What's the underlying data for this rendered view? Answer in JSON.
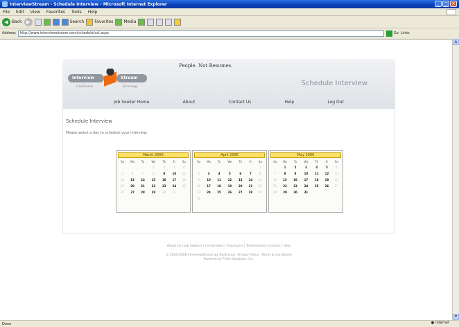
{
  "window": {
    "title": "InterviewStream - Schedule Interview - Microsoft Internet Explorer"
  },
  "menu": [
    "File",
    "Edit",
    "View",
    "Favorites",
    "Tools",
    "Help"
  ],
  "toolbar": {
    "back": "Back",
    "search": "Search",
    "favorites": "Favorites",
    "media": "Media"
  },
  "address": {
    "label": "Address",
    "url": "http://www.interviewstream.com/schedule/cal.aspx",
    "go": "Go",
    "links": "Links"
  },
  "status": {
    "left": "Done",
    "zone": "Internet"
  },
  "site": {
    "logo_left": "Interview",
    "logo_right": "Stream",
    "logo_left_sub": "A RedFusion",
    "logo_right_sub": "Technology",
    "tagline": "People. Not Resumes.",
    "section_title": "Schedule Interview",
    "nav": [
      "Job Seeker Home",
      "About",
      "Contact Us",
      "Help",
      "Log Out"
    ]
  },
  "main": {
    "title": "Schedule Interview",
    "hint": "Please select a day to schedule your interview:"
  },
  "calendars": [
    {
      "month": "March 2006",
      "weekdays": [
        "Su",
        "Mo",
        "Tu",
        "We",
        "Th",
        "Fr",
        "Sa"
      ],
      "rows": [
        [
          "",
          "",
          "",
          "1",
          "2",
          "3",
          "4"
        ],
        [
          "5",
          "6",
          "7",
          "8",
          "9",
          "10",
          "11"
        ],
        [
          "12",
          "13",
          "14",
          "15",
          "16",
          "17",
          "18"
        ],
        [
          "19",
          "20",
          "21",
          "22",
          "23",
          "24",
          "25"
        ],
        [
          "26",
          "27",
          "28",
          "29",
          "30",
          "31",
          ""
        ]
      ],
      "bold": [
        "9",
        "10",
        "13",
        "14",
        "15",
        "16",
        "17",
        "20",
        "21",
        "22",
        "23",
        "24",
        "27",
        "28",
        "29"
      ]
    },
    {
      "month": "April 2006",
      "weekdays": [
        "Su",
        "Mo",
        "Tu",
        "We",
        "Th",
        "Fr",
        "Sa"
      ],
      "rows": [
        [
          "",
          "",
          "",
          "",
          "",
          "",
          "1"
        ],
        [
          "2",
          "3",
          "4",
          "5",
          "6",
          "7",
          "8"
        ],
        [
          "9",
          "10",
          "11",
          "12",
          "13",
          "14",
          "15"
        ],
        [
          "16",
          "17",
          "18",
          "19",
          "20",
          "21",
          "22"
        ],
        [
          "23",
          "24",
          "25",
          "26",
          "27",
          "28",
          "29"
        ],
        [
          "30",
          "",
          "",
          "",
          "",
          "",
          ""
        ]
      ],
      "bold": [
        "3",
        "4",
        "5",
        "6",
        "7",
        "10",
        "11",
        "12",
        "13",
        "14",
        "17",
        "18",
        "19",
        "20",
        "21",
        "24",
        "25",
        "26",
        "27",
        "28"
      ]
    },
    {
      "month": "May 2006",
      "weekdays": [
        "Su",
        "Mo",
        "Tu",
        "We",
        "Th",
        "Fr",
        "Sa"
      ],
      "rows": [
        [
          "",
          "1",
          "2",
          "3",
          "4",
          "5",
          "6"
        ],
        [
          "7",
          "8",
          "9",
          "10",
          "11",
          "12",
          "13"
        ],
        [
          "14",
          "15",
          "16",
          "17",
          "18",
          "19",
          "20"
        ],
        [
          "21",
          "22",
          "23",
          "24",
          "25",
          "26",
          "27"
        ],
        [
          "28",
          "29",
          "30",
          "31",
          "",
          "",
          ""
        ]
      ],
      "bold": [
        "1",
        "2",
        "3",
        "4",
        "5",
        "8",
        "9",
        "10",
        "11",
        "12",
        "15",
        "16",
        "17",
        "18",
        "19",
        "22",
        "23",
        "24",
        "25",
        "26",
        "29",
        "30",
        "31"
      ]
    }
  ],
  "footer": {
    "links": "About Us | Job Seekers | Universities | Employers | Testimonials | Contact | Help",
    "copy1": "© 2005-2006 InterviewStream by RedFusion. Privacy Policy - Terms & Conditions",
    "copy2": "Powered by Prism Solutions, Inc."
  }
}
